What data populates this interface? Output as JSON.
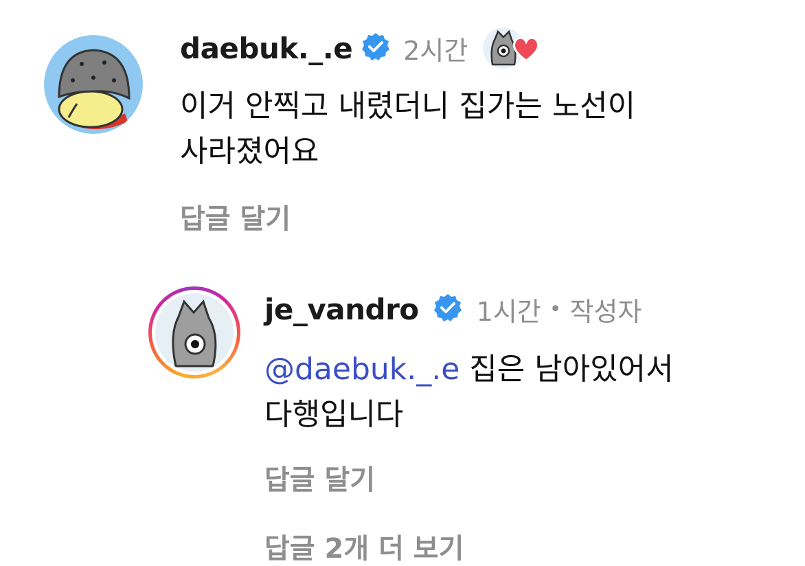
{
  "comments": [
    {
      "username": "daebuk._.e",
      "time": "2시간",
      "line1": "이거 안찍고 내렸더니 집가는 노선이",
      "line2": "사라졌어요",
      "reply_label": "답글 달기"
    },
    {
      "username": "je_vandro",
      "time": "1시간",
      "separator": "•",
      "author_tag": "작성자",
      "mention": "@daebuk._.e",
      "line1_rest": " 집은 남아있어서",
      "line2": "다행입니다",
      "reply_label": "답글 달기"
    }
  ],
  "more_replies_label": "답글 2개 더 보기",
  "colors": {
    "verified": "#3797f0",
    "mention": "#3b4fc4",
    "heart": "#ed4956",
    "muted": "#8e8e8e"
  },
  "icons": [
    "verified-badge-icon",
    "heart-icon",
    "story-ring"
  ]
}
